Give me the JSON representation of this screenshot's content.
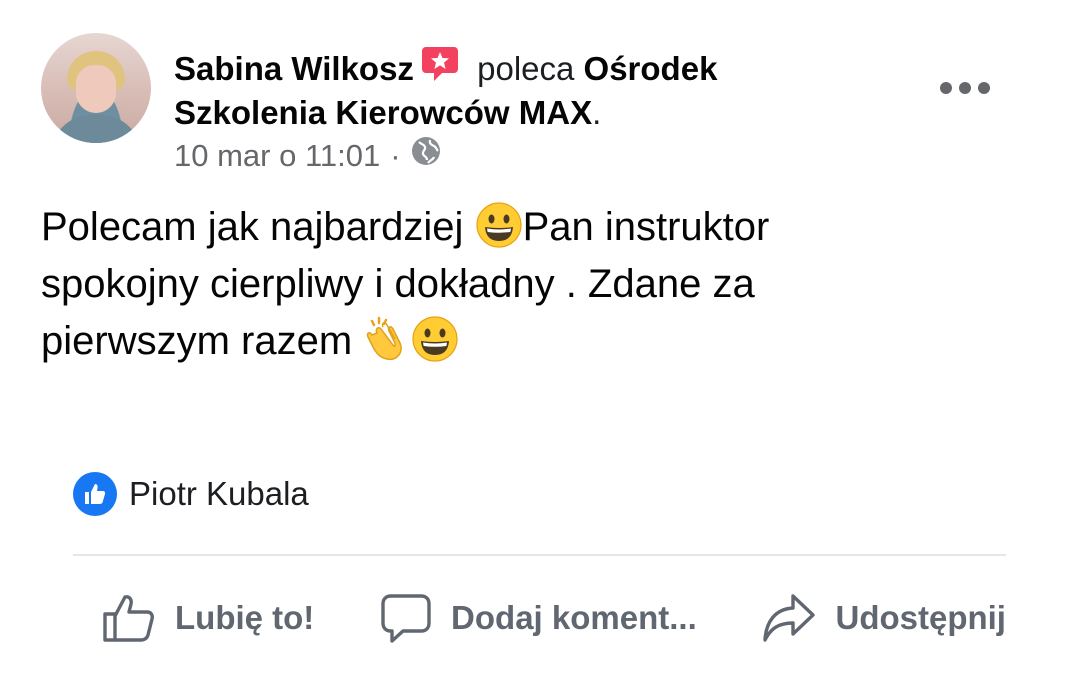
{
  "post": {
    "author": "Sabina Wilkosz",
    "verb": "poleca",
    "page_name": "Ośrodek Szkolenia Kierowców MAX",
    "page_suffix": ".",
    "timestamp": "10 mar o 11:01",
    "separator": "·",
    "privacy_icon": "globe-icon",
    "body_line1": "Polecam jak najbardziej ",
    "body_line1b": "Pan instruktor spokojny cierpliwy i dokładny . Zdane za pierwszym razem ",
    "emojis": [
      "grinning-face",
      "clapping-hands",
      "grinning-face"
    ]
  },
  "reactions": {
    "icon": "like-icon",
    "names": "Piotr Kubala"
  },
  "actions": {
    "like": "Lubię to!",
    "comment": "Dodaj koment...",
    "share": "Udostępnij"
  },
  "colors": {
    "facebook_blue": "#1877f2",
    "recommend_red": "#f3425f",
    "secondary_text": "#65676b"
  }
}
